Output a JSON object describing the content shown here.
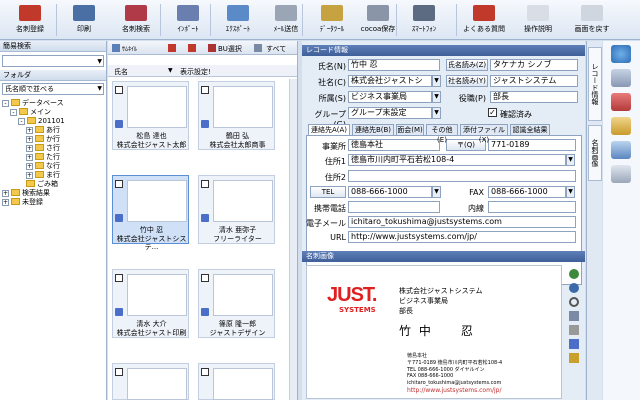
{
  "toolbar": {
    "items": [
      {
        "label": "名刺登録",
        "icon": "register-card-icon",
        "color": "#c0392b"
      },
      {
        "label": "印刷",
        "icon": "print-icon",
        "color": "#4a6fa5"
      },
      {
        "label": "名刺検索",
        "icon": "search-card-icon",
        "color": "#b03a48"
      },
      {
        "label": "ｲﾝﾎﾟｰﾄ",
        "icon": "import-icon",
        "color": "#6a7fb0"
      },
      {
        "label": "ｴｸｽﾎﾟｰﾄ",
        "icon": "export-icon",
        "color": "#5b8ac9"
      },
      {
        "label": "ﾒｰﾙ送信",
        "icon": "mail-icon",
        "color": "#9aa6b5"
      },
      {
        "label": "ﾃﾞｰﾀﾂｰﾙ",
        "icon": "data-tool-icon",
        "color": "#c7a240"
      },
      {
        "label": "cocoa保存",
        "icon": "cocoa-save-icon",
        "color": "#8b95a8"
      },
      {
        "label": "ｽﾏｰﾄﾌｫﾝ",
        "icon": "smartphone-icon",
        "color": "#5d6b82"
      },
      {
        "label": "よくある質問",
        "icon": "faq-icon",
        "color": "#c0392b"
      },
      {
        "label": "操作説明",
        "icon": "manual-icon",
        "color": "#d8dde6"
      },
      {
        "label": "画面を戻す",
        "icon": "restore-screen-icon",
        "color": "#cfd6e0"
      }
    ]
  },
  "left": {
    "search_header": "簡易検索",
    "folder_header": "フォルダ",
    "sort_select": "氏名順で並べる",
    "tree": [
      {
        "label": "データベース",
        "indent": 1,
        "pm": "-"
      },
      {
        "label": "メイン",
        "indent": 2,
        "pm": "-"
      },
      {
        "label": "201101",
        "indent": 3,
        "pm": "-"
      },
      {
        "label": "あ行",
        "indent": 4,
        "pm": "+"
      },
      {
        "label": "か行",
        "indent": 4,
        "pm": "+"
      },
      {
        "label": "さ行",
        "indent": 4,
        "pm": "+"
      },
      {
        "label": "た行",
        "indent": 4,
        "pm": "+"
      },
      {
        "label": "な行",
        "indent": 4,
        "pm": "+"
      },
      {
        "label": "ま行",
        "indent": 4,
        "pm": "+"
      },
      {
        "label": "ごみ箱",
        "indent": 4,
        "pm": ""
      },
      {
        "label": "検索結果",
        "indent": 1,
        "pm": "+"
      },
      {
        "label": "未登録",
        "indent": 1,
        "pm": "+"
      }
    ]
  },
  "mid": {
    "toolbar_labels": [
      "ｻﾑﾈｲﾙ",
      "BU選択",
      "すべて"
    ],
    "col_name": "氏名",
    "col_settings": "表示設定!",
    "cards": [
      {
        "name": "松島 達也",
        "company": "株式会社ジャスト太郎"
      },
      {
        "name": "鶴田 弘",
        "company": "株式会社太郎商事"
      },
      {
        "name": "竹中 忍",
        "company": "株式会社ジャストシステ..."
      },
      {
        "name": "清水 亜弥子",
        "company": "フリーライター"
      },
      {
        "name": "清水 大介",
        "company": "株式会社ジャスト印刷"
      },
      {
        "name": "篠原 隆一郎",
        "company": "ジャストデザイン"
      }
    ]
  },
  "record": {
    "header": "レコード情報",
    "name_label": "氏名(N)",
    "name_value": "竹中 忍",
    "name_reading_label": "氏名読み(Z)",
    "name_reading_value": "タケナカ シノブ",
    "company_label": "社名(C)",
    "company_value": "株式会社ジャストシ",
    "company_reading_label": "社名読み(Y)",
    "company_reading_value": "ジャストシステム",
    "dept_label": "所属(S)",
    "dept_value": "ビジネス事業局",
    "title_label": "役職(P)",
    "title_value": "部長",
    "group_label": "グループ(G)",
    "group_value": "グループ未設定",
    "verified_label": "確認済み",
    "tabs": [
      "連絡先A(A)",
      "連絡先B(B)",
      "面会(M)",
      "その他(E)",
      "添付ファイル(X)",
      "認識全結果"
    ],
    "office_label": "事業所",
    "office_value": "徳島本社",
    "zip_label": "〒(Q)",
    "zip_value": "771-0189",
    "addr1_label": "住所1",
    "addr1_value": "徳島市川内町平石若松108-4",
    "addr2_label": "住所2",
    "addr2_value": "",
    "tel_label": "TEL",
    "tel_value": "088-666-1000",
    "fax_label": "FAX",
    "fax_value": "088-666-1000",
    "mobile_label": "携帯電話",
    "mobile_value": "",
    "ext_label": "内線",
    "ext_value": "",
    "email_label": "電子メール",
    "email_value": "ichitaro_tokushima@justsystems.com",
    "url_label": "URL",
    "url_value": "http://www.justsystems.com/jp/"
  },
  "card_image": {
    "header": "名刺画像",
    "logo": "JUST.",
    "logo_sub": "SYSTEMS",
    "company": "株式会社ジャストシステム",
    "dept": "ビジネス事業局",
    "title": "部長",
    "name": "竹 中　　忍",
    "office": "徳島本社",
    "addr": "〒771-0189 徳島市川内町平石若松108-4",
    "tel": "TEL 088-666-1000 ダイヤルイン",
    "fax": "FAX 088-666-1000",
    "email": "ichitaro_tokushima@justsystems.com",
    "url": "http://www.justsystems.com/jp/"
  },
  "vtabs": [
    "レコード情報",
    "名刺画像"
  ]
}
